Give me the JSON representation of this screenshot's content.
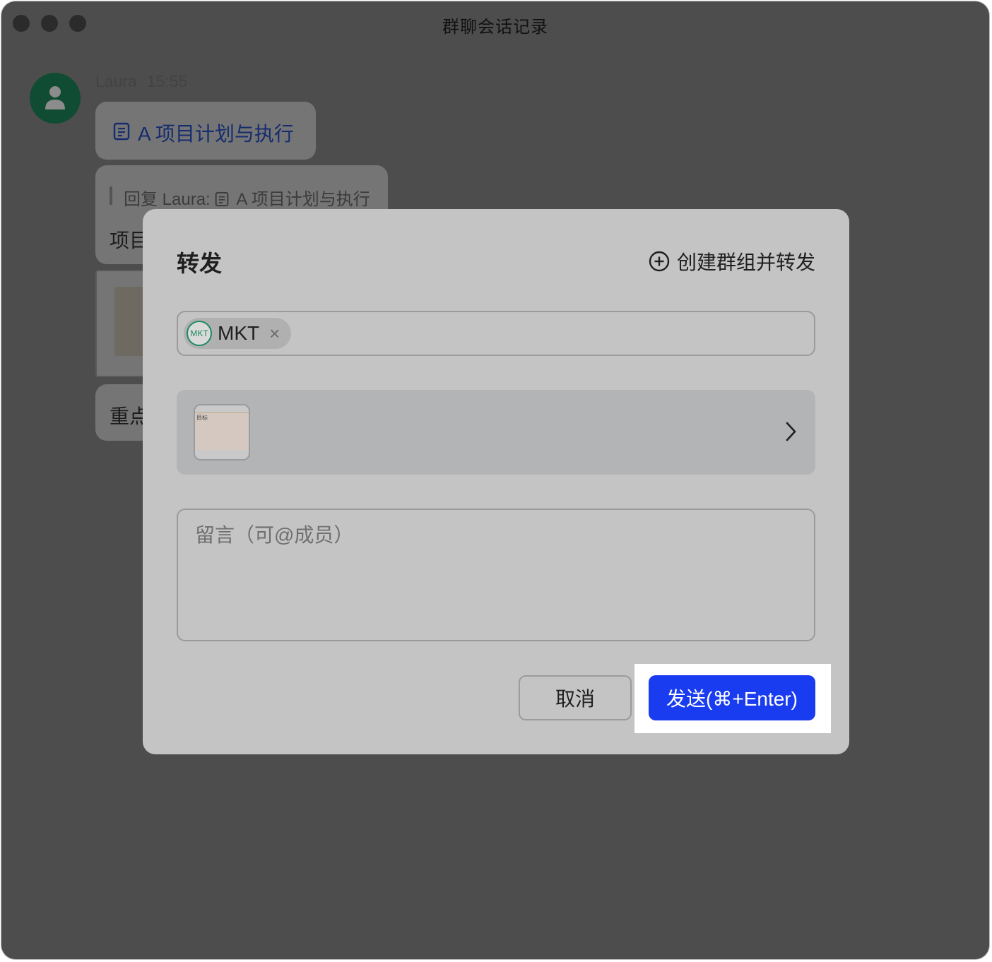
{
  "window": {
    "title": "群聊会话记录"
  },
  "chat": {
    "sender": "Laura",
    "time": "15:55",
    "doc_title": "A 项目计划与执行",
    "reply_quote": "回复 Laura: ",
    "reply_doc": "A 项目计划与执行",
    "reply_text_partial": "项目",
    "partial_text_2": "重点"
  },
  "dialog": {
    "title": "转发",
    "create_group_label": "创建群组并转发",
    "recipient": {
      "avatar_text": "MKT",
      "name": "MKT",
      "remove_glyph": "×"
    },
    "preview_thumb_text": "目标",
    "message_placeholder": "留言（可@成员）",
    "cancel_label": "取消",
    "send_label": "发送(⌘+Enter)"
  },
  "colors": {
    "send_button": "#1a3cf0",
    "avatar_green": "#1e8a60",
    "doc_link": "#2750c8"
  },
  "icons": {
    "create_group": "plus-circle-icon",
    "remove_chip": "close-icon",
    "preview_chevron": "chevron-right-icon",
    "doc": "document-icon",
    "user_avatar": "user-icon"
  }
}
